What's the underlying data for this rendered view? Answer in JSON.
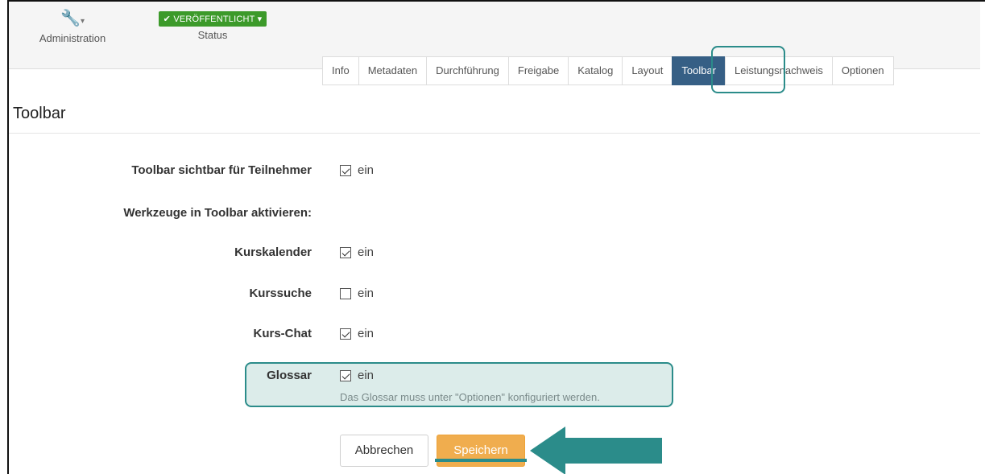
{
  "header": {
    "admin_label": "Administration",
    "status_badge": "VERÖFFENTLICHT",
    "status_label": "Status"
  },
  "tabs": [
    {
      "label": "Info"
    },
    {
      "label": "Metadaten"
    },
    {
      "label": "Durchführung"
    },
    {
      "label": "Freigabe"
    },
    {
      "label": "Katalog"
    },
    {
      "label": "Layout"
    },
    {
      "label": "Toolbar",
      "active": true
    },
    {
      "label": "Leistungsnachweis"
    },
    {
      "label": "Optionen"
    }
  ],
  "page": {
    "title": "Toolbar"
  },
  "form": {
    "toolbar_visible": {
      "label": "Toolbar sichtbar für Teilnehmer",
      "checkbox": "ein",
      "checked": true
    },
    "tools_heading": "Werkzeuge in Toolbar aktivieren:",
    "kurskalender": {
      "label": "Kurskalender",
      "checkbox": "ein",
      "checked": true
    },
    "kurssuche": {
      "label": "Kurssuche",
      "checkbox": "ein",
      "checked": false
    },
    "kurschat": {
      "label": "Kurs-Chat",
      "checkbox": "ein",
      "checked": true
    },
    "glossar": {
      "label": "Glossar",
      "checkbox": "ein",
      "checked": true,
      "hint": "Das Glossar muss unter \"Optionen\" konfiguriert werden."
    }
  },
  "buttons": {
    "cancel": "Abbrechen",
    "save": "Speichern"
  },
  "colors": {
    "accent": "#2b8c8a",
    "active_tab": "#365f85",
    "save": "#f0ad4e",
    "badge": "#3c9a2a"
  }
}
